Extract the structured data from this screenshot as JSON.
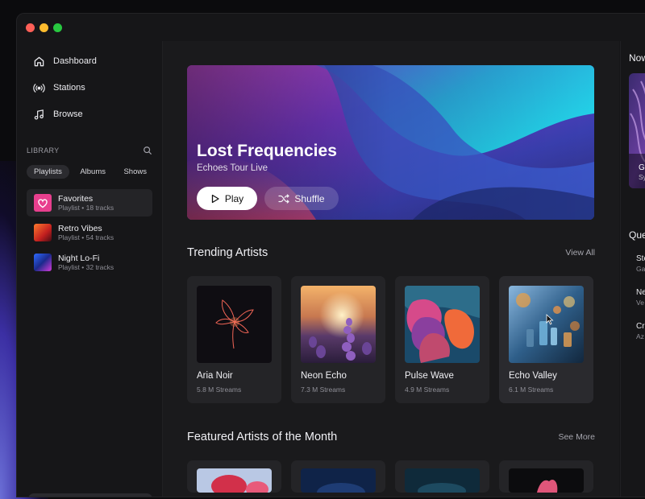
{
  "colors": {
    "accent": "#ffffff",
    "background": "#161618",
    "card": "#242427"
  },
  "sidebar": {
    "nav": [
      {
        "label": "Dashboard",
        "icon": "home-icon"
      },
      {
        "label": "Stations",
        "icon": "broadcast-icon"
      },
      {
        "label": "Browse",
        "icon": "music-note-icon"
      }
    ],
    "library_label": "LIBRARY",
    "chips": [
      "Playlists",
      "Albums",
      "Shows"
    ],
    "playlists": [
      {
        "name": "Favorites",
        "sub": "Playlist • 18 tracks"
      },
      {
        "name": "Retro Vibes",
        "sub": "Playlist • 54 tracks"
      },
      {
        "name": "Night Lo-Fi",
        "sub": "Playlist • 32 tracks"
      }
    ]
  },
  "hero": {
    "title": "Lost Frequencies",
    "subtitle": "Echoes Tour Live",
    "play_label": "Play",
    "shuffle_label": "Shuffle"
  },
  "trending": {
    "title": "Trending Artists",
    "link": "View All",
    "artists": [
      {
        "name": "Aria Noir",
        "streams": "5.8 M Streams"
      },
      {
        "name": "Neon Echo",
        "streams": "7.3 M Streams"
      },
      {
        "name": "Pulse Wave",
        "streams": "4.9 M Streams"
      },
      {
        "name": "Echo Valley",
        "streams": "6.1 M Streams"
      }
    ]
  },
  "featured": {
    "title": "Featured Artists of the Month",
    "link": "See More"
  },
  "right_panel": {
    "now_title": "Now",
    "now_t1": "G",
    "now_t2": "Sy",
    "queue_title": "Que",
    "queue": [
      {
        "a": "Ste",
        "b": "Ga"
      },
      {
        "a": "Ne",
        "b": "Ve"
      },
      {
        "a": "Cr",
        "b": "Az"
      }
    ]
  }
}
